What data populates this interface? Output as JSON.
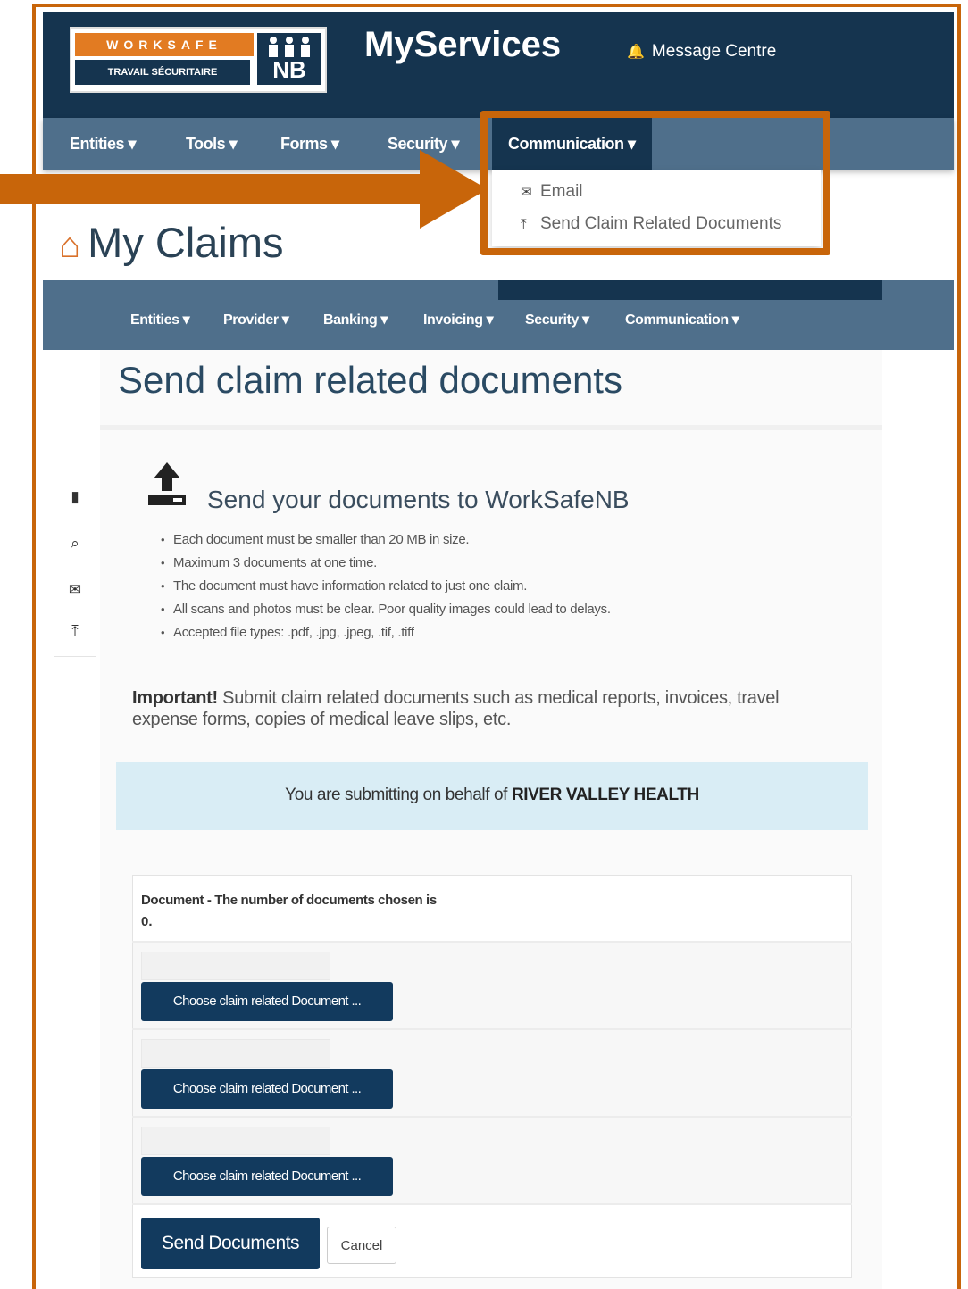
{
  "header": {
    "logo": {
      "line1": "WORKSAFE",
      "line2": "TRAVAIL SÉCURITAIRE",
      "mark": "NB"
    },
    "app_title": "MyServices",
    "message_centre": "Message Centre"
  },
  "top_nav": {
    "items": [
      "Entities",
      "Tools",
      "Forms",
      "Security",
      "Communication"
    ],
    "active": "Communication"
  },
  "dropdown": {
    "items": [
      {
        "label": "Email",
        "icon": "envelope-icon"
      },
      {
        "label": "Send Claim Related Documents",
        "icon": "upload-icon"
      }
    ]
  },
  "page": {
    "title": "My Claims"
  },
  "secondary_nav": {
    "items": [
      "Entities",
      "Provider",
      "Banking",
      "Invoicing",
      "Security",
      "Communication"
    ]
  },
  "content": {
    "title": "Send claim related documents",
    "upload_heading": "Send your documents to WorkSafeNB",
    "rules": [
      "Each document must be smaller than 20 MB in size.",
      "Maximum 3 documents at one time.",
      "The document must have information related to just one claim.",
      "All scans and photos must be clear. Poor quality images could lead to delays.",
      "Accepted file types: .pdf, .jpg, .jpeg, .tif, .tiff"
    ],
    "important_label": "Important!",
    "important_text": "Submit claim related documents such as medical reports, invoices, travel expense forms, copies of medical leave slips, etc.",
    "behalf_prefix": "You are submitting on behalf of",
    "behalf_entity": "RIVER VALLEY HEALTH",
    "doc_count_label": "Document - The number of documents chosen is",
    "doc_count_value": "0.",
    "choose_button_label": "Choose claim related Document ...",
    "send_button": "Send Documents",
    "cancel_button": "Cancel"
  },
  "colors": {
    "header_bg": "#15344f",
    "nav_bg": "#4f6f8b",
    "accent_orange": "#c8650a",
    "button_blue": "#123a5e",
    "info_bg": "#d9edf5"
  }
}
